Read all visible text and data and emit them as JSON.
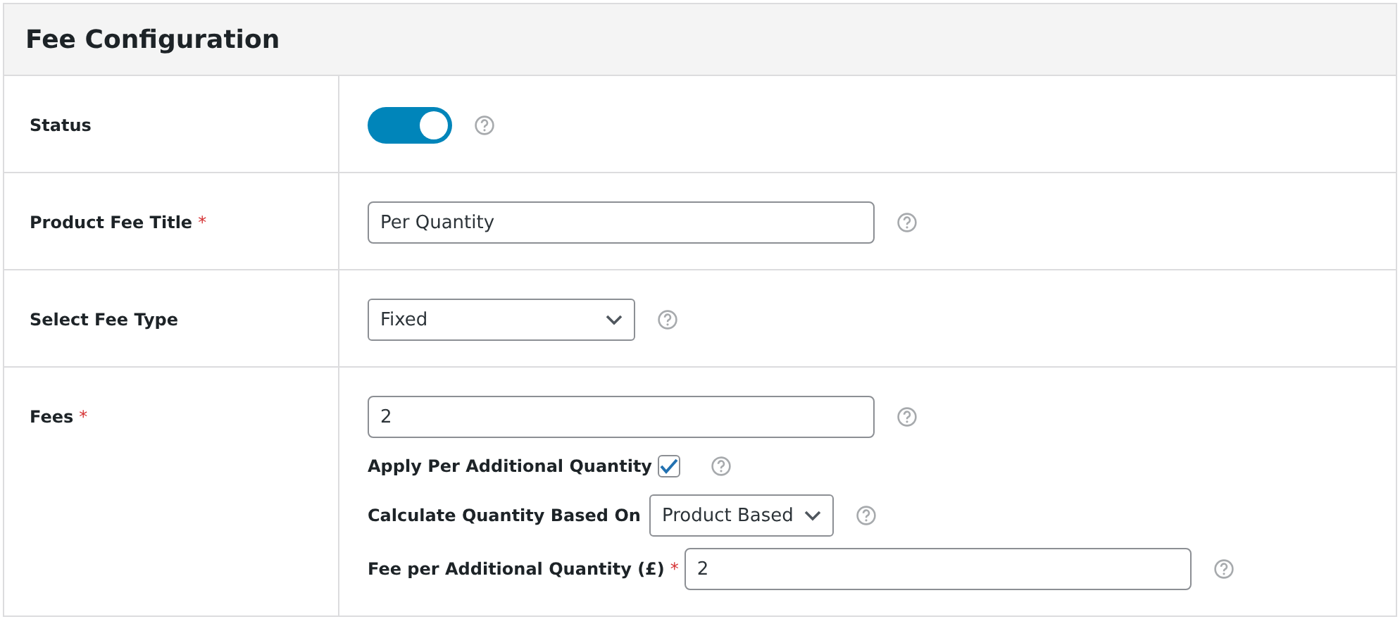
{
  "panel": {
    "title": "Fee Configuration"
  },
  "rows": [
    {
      "label": "Status",
      "kind": "toggle",
      "on": true
    },
    {
      "label": "Product Fee Title",
      "required_mark": "*",
      "kind": "text",
      "value": "Per Quantity"
    },
    {
      "label": "Select Fee Type",
      "kind": "select",
      "value": "Fixed"
    },
    {
      "label": "Fees",
      "required_mark": "*",
      "kind": "text",
      "value": "2",
      "extras": [
        {
          "kind": "checkbox",
          "label": "Apply Per Additional Quantity",
          "checked": true
        },
        {
          "kind": "select",
          "label": "Calculate Quantity Based On",
          "value": "Product Based"
        },
        {
          "kind": "text",
          "label": "Fee per Additional Quantity (£)",
          "required_mark": "*",
          "value": "2"
        }
      ]
    }
  ]
}
